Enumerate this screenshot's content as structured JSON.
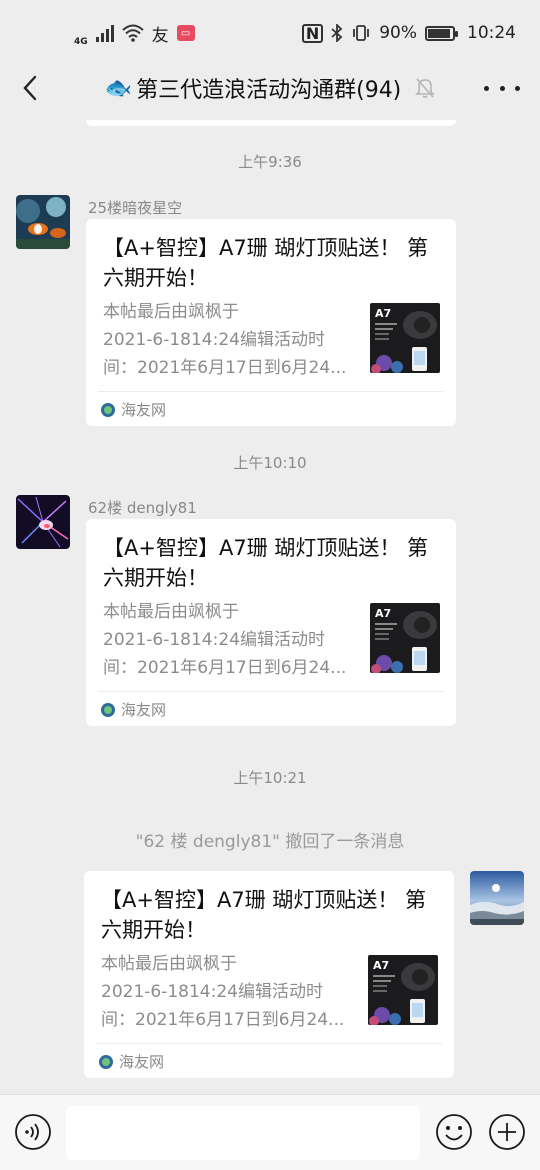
{
  "status_bar": {
    "network": "4G",
    "wifi_badge": "友",
    "battery": "90%",
    "battery_level": 0.9,
    "time": "10:24"
  },
  "nav": {
    "title_emoji": "🐟",
    "title": "第三代造浪活动沟通群(94)"
  },
  "messages": [
    {
      "time": "上午9:36",
      "sender": "25楼暗夜星空",
      "card": {
        "title": "【A+智控】A7珊 瑚灯顶贴送！ 第六期开始！",
        "desc_lines": [
          "本帖最后由飒枫于",
          "2021-6-1814:24编辑活动时",
          "间：2021年6月17日到6月24..."
        ],
        "thumb_label": "A7",
        "source": "海友网"
      }
    },
    {
      "time": "上午10:10",
      "sender": "62楼 dengly81",
      "card": {
        "title": "【A+智控】A7珊 瑚灯顶贴送！ 第六期开始！",
        "desc_lines": [
          "本帖最后由飒枫于",
          "2021-6-1814:24编辑活动时",
          "间：2021年6月17日到6月24..."
        ],
        "thumb_label": "A7",
        "source": "海友网"
      }
    },
    {
      "time": "上午10:21",
      "recall": "\"62 楼 dengly81\" 撤回了一条消息",
      "card": {
        "title": "【A+智控】A7珊 瑚灯顶贴送！ 第六期开始！",
        "desc_lines": [
          "本帖最后由飒枫于",
          "2021-6-1814:24编辑活动时",
          "间：2021年6月17日到6月24..."
        ],
        "thumb_label": "A7",
        "source": "海友网"
      }
    }
  ],
  "icons": {
    "back": "chevron-left-icon",
    "mute": "bell-off-icon",
    "more": "more-dots-icon",
    "voice": "voice-icon",
    "emoji": "emoji-icon",
    "plus": "plus-icon"
  },
  "colors": {
    "background": "#ededed",
    "card": "#ffffff",
    "bottom_bar": "#f7f7f7",
    "meta_text": "#8a8a8a"
  }
}
